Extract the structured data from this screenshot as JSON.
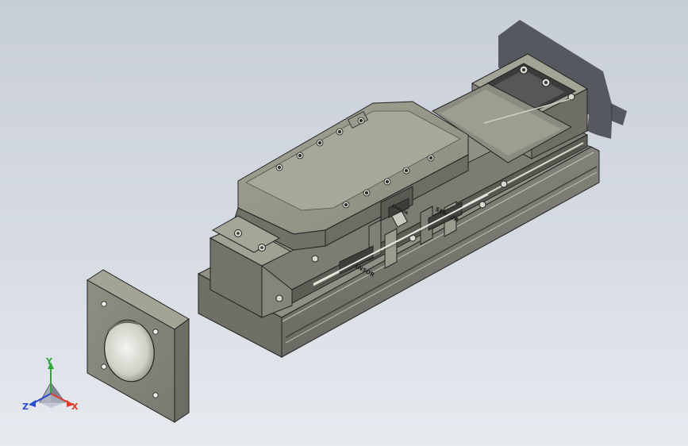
{
  "viewport": {
    "background_top": "#c8ced8",
    "background_bottom": "#e7eaef"
  },
  "model": {
    "body_color": "#7e7e73",
    "face_color": "#9a9a8c",
    "dark_color": "#4a4a44",
    "edge_color": "#222222",
    "sensor_labels": [
      "SENSOR",
      "SENSOR",
      "SENSOR"
    ]
  },
  "triad": {
    "x_label": "X",
    "y_label": "Y",
    "z_label": "Z",
    "x_color": "#e23a2a",
    "y_color": "#2eaa3a",
    "z_color": "#2a4ad0"
  }
}
